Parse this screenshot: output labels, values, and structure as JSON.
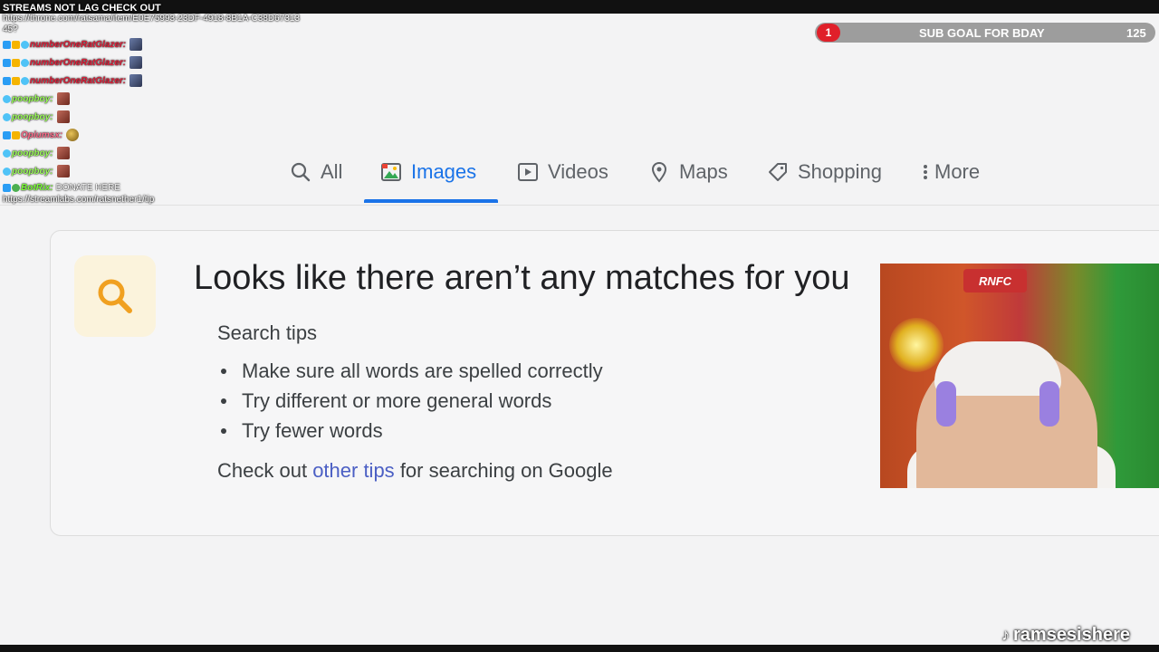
{
  "chat": {
    "header_line": "STREAMS NOT LAG CHECK OUT",
    "header_url": "https://throne.com/ratsama/item/E0E75993-23DF-4918-8B1A-C38D6731345?",
    "messages": [
      {
        "user": "numberOneRatGlazer:",
        "color": "red",
        "emote": "blue"
      },
      {
        "user": "numberOneRatGlazer:",
        "color": "red",
        "emote": "blue"
      },
      {
        "user": "numberOneRatGlazer:",
        "color": "red",
        "emote": "blue"
      },
      {
        "user": "poopboy:",
        "color": "green",
        "emote": "red"
      },
      {
        "user": "poopboy:",
        "color": "green",
        "emote": "red"
      },
      {
        "user": "Opiumsx:",
        "color": "pink",
        "emote": "gold"
      },
      {
        "user": "poopboy:",
        "color": "green",
        "emote": "red"
      },
      {
        "user": "poopboy:",
        "color": "green",
        "emote": "red"
      }
    ],
    "bot_user": "BotRix:",
    "bot_text": "DONATE HERE",
    "bot_url": "https://streamlabs.com/ratsnether1/tip"
  },
  "sub_goal": {
    "current": "1",
    "label": "SUB GOAL FOR BDAY",
    "target": "125"
  },
  "tabs": [
    {
      "label": "All",
      "icon": "search-icon"
    },
    {
      "label": "Images",
      "icon": "image-icon",
      "active": true
    },
    {
      "label": "Videos",
      "icon": "play-icon"
    },
    {
      "label": "Maps",
      "icon": "map-pin-icon"
    },
    {
      "label": "Shopping",
      "icon": "tag-icon"
    },
    {
      "label": "More",
      "icon": "more-vert-icon"
    }
  ],
  "results": {
    "headline": "Looks like there aren’t any matches for you",
    "tips_title": "Search tips",
    "tips": [
      "Make sure all words are spelled correctly",
      "Try different or more general words",
      "Try fewer words"
    ],
    "checkout_prefix": "Check out",
    "checkout_link": "other tips",
    "checkout_suffix": "for searching on Google"
  },
  "webcam": {
    "banner_text": "RNFC"
  },
  "watermark": {
    "handle": "ramsesishere"
  },
  "colors": {
    "accent_blue": "#1a73e8",
    "goal_red": "#e0202a",
    "link": "#4b5fc4"
  }
}
